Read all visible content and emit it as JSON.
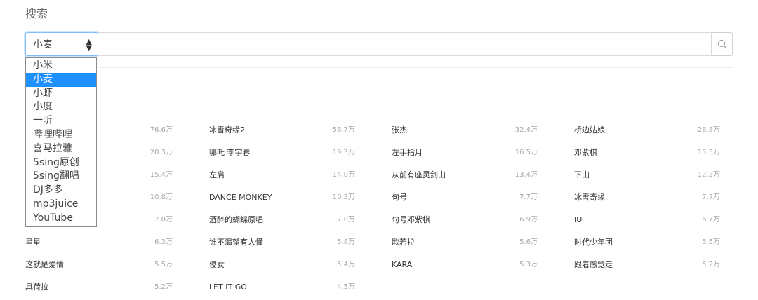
{
  "page": {
    "title": "搜索"
  },
  "search": {
    "selected_source": "小麦",
    "query": "",
    "placeholder": ""
  },
  "dropdown": {
    "options": [
      "小米",
      "小麦",
      "小虾",
      "小度",
      "一听",
      "哔哩哔哩",
      "喜马拉雅",
      "5sing原创",
      "5sing翻唱",
      "DJ多多",
      "mp3juice",
      "YouTube"
    ],
    "selected_index": 1
  },
  "hot": {
    "rows": [
      [
        {
          "name": "",
          "count": "76.6万"
        },
        {
          "name": "冰雪奇缘2",
          "count": "58.7万"
        },
        {
          "name": "张杰",
          "count": "32.4万"
        },
        {
          "name": "桥边姑娘",
          "count": "28.8万"
        }
      ],
      [
        {
          "name": "",
          "count": "20.3万"
        },
        {
          "name": "哪吒 李宇春",
          "count": "19.3万"
        },
        {
          "name": "左手指月",
          "count": "16.5万"
        },
        {
          "name": "邓紫棋",
          "count": "15.5万"
        }
      ],
      [
        {
          "name": "",
          "count": "15.4万"
        },
        {
          "name": "左肩",
          "count": "14.0万"
        },
        {
          "name": "从前有座灵剑山",
          "count": "13.4万"
        },
        {
          "name": "下山",
          "count": "12.2万"
        }
      ],
      [
        {
          "name": "",
          "count": "10.8万"
        },
        {
          "name": "DANCE MONKEY",
          "count": "10.3万"
        },
        {
          "name": "句号",
          "count": "7.7万"
        },
        {
          "name": "冰雪奇缘",
          "count": "7.7万"
        }
      ],
      [
        {
          "name": "",
          "count": "7.0万"
        },
        {
          "name": "酒醉的蝴蝶原唱",
          "count": "7.0万"
        },
        {
          "name": "句号邓紫棋",
          "count": "6.9万"
        },
        {
          "name": "IU",
          "count": "6.7万"
        }
      ],
      [
        {
          "name": "星星",
          "count": "6.3万"
        },
        {
          "name": "谁不渴望有人懂",
          "count": "5.8万"
        },
        {
          "name": "欧若拉",
          "count": "5.6万"
        },
        {
          "name": "时代少年团",
          "count": "5.5万"
        }
      ],
      [
        {
          "name": "这就是爱情",
          "count": "5.5万"
        },
        {
          "name": "傻女",
          "count": "5.4万"
        },
        {
          "name": "KARA",
          "count": "5.3万"
        },
        {
          "name": "跟着感觉走",
          "count": "5.2万"
        }
      ],
      [
        {
          "name": "具荷拉",
          "count": "5.2万"
        },
        {
          "name": "LET IT GO",
          "count": "4.5万"
        }
      ]
    ]
  },
  "colors": {
    "focus": "#80bdff",
    "selected": "#1e90ff",
    "count_text": "#a8a8a8"
  },
  "icons": {
    "search_button": "search-icon",
    "select_arrow": "sort-arrows-icon"
  }
}
